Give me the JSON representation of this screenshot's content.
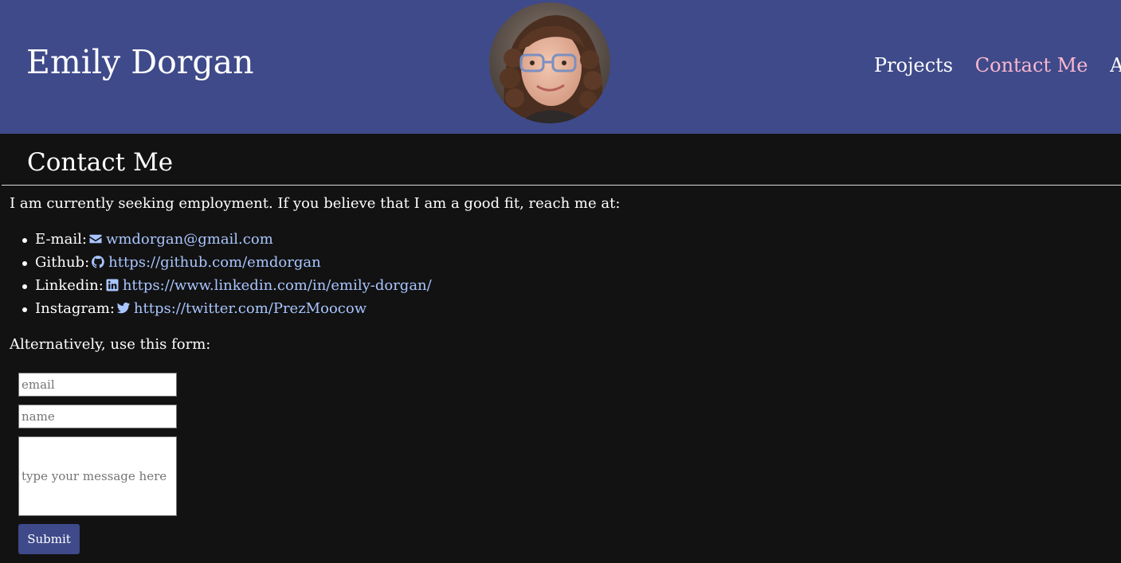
{
  "header": {
    "site_title": "Emily Dorgan",
    "nav": [
      {
        "label": "Projects",
        "active": false
      },
      {
        "label": "Contact Me",
        "active": true
      },
      {
        "label": "About",
        "active": false
      }
    ],
    "avatar_icon": "profile-photo"
  },
  "main": {
    "heading": "Contact Me",
    "intro": "I am currently seeking employment. If you believe that I am a good fit, reach me at:",
    "contacts": [
      {
        "label": "E-mail:",
        "icon": "envelope-icon",
        "link": "wmdorgan@gmail.com"
      },
      {
        "label": "Github:",
        "icon": "github-icon",
        "link": "https://github.com/emdorgan"
      },
      {
        "label": "Linkedin:",
        "icon": "linkedin-icon",
        "link": "https://www.linkedin.com/in/emily-dorgan/"
      },
      {
        "label": "Instagram:",
        "icon": "twitter-icon",
        "link": "https://twitter.com/PrezMoocow"
      }
    ],
    "alt_text": "Alternatively, use this form:"
  },
  "form": {
    "email_placeholder": "email",
    "email_value": "",
    "name_placeholder": "name",
    "name_value": "",
    "message_placeholder": "type your message here",
    "message_value": "",
    "submit_label": "Submit"
  },
  "colors": {
    "header_bg": "#3f4a8a",
    "page_bg": "#121212",
    "link": "#a9c5ff",
    "active_nav": "#f9b8cf"
  }
}
